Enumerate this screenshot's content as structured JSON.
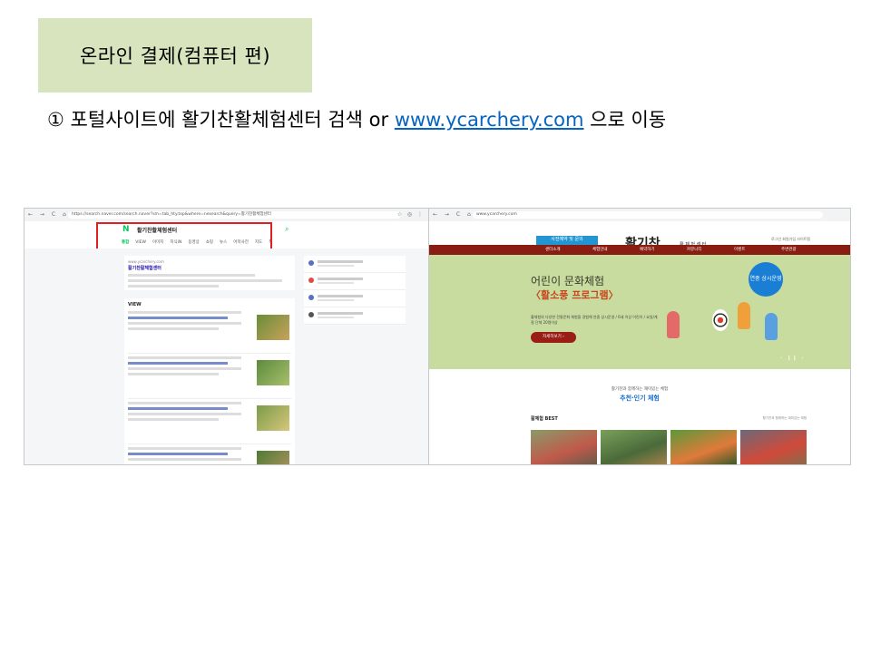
{
  "slide": {
    "title": "온라인 결제(컴퓨터 편)",
    "step_prefix": "① 포털사이트에 활기찬활체험센터 검색 or ",
    "step_link": "www.ycarchery.com",
    "step_suffix": " 으로 이동"
  },
  "left_screenshot": {
    "nav_buttons": "← → C ⌂",
    "url": "https://search.naver.com/search.naver?sm=tab_hty.top&where=nexearch&query=활기찬활체험센터",
    "right_icons": "☆ ◎ ⋮",
    "logo": "N",
    "query": "활기찬활체험센터",
    "search_icon": "search-icon",
    "tabs": [
      "통합",
      "VIEW",
      "이미지",
      "지식iN",
      "동영상",
      "쇼핑",
      "뉴스",
      "어학사전",
      "지도",
      "책"
    ],
    "active_tab": "통합",
    "result_url": "www.ycarchery.com",
    "result_title": "활기찬활체험센터",
    "view_label": "VIEW"
  },
  "right_screenshot": {
    "nav_buttons": "← → C ⌂",
    "url": "www.ycarchery.com",
    "reserve_line1": "사전예약 및 문의",
    "reserve_line2": "054-653-2434",
    "logo": "활기찬",
    "logo_sub": "활 체 험 센 터",
    "top_links": "로그인   회원가입   사이트맵",
    "nav_items": [
      "센터소개",
      "체험안내",
      "예약하기",
      "커뮤니티",
      "이벤트",
      "주변관광"
    ],
    "hero_title": "어린이 문화체험",
    "hero_subtitle": "〈활소풍 프로그램〉",
    "hero_desc": "활체험의 다양한 전통문화 체험을 경험해 연중 상시운영 / 6세 이상 어린이 / 요일/계절 단체 20명이상",
    "hero_button": "자세히보기  ›",
    "badge": "연중 상시운영",
    "arrows": "‹ ❙❙ ›",
    "mid_sub": "활기찬과 함께하는 재미있는 체험",
    "mid_title_a": "추천·",
    "mid_title_b": "인기 체험",
    "best_label": "활체험 BEST",
    "best_right": "활기찬과 함께하는 재미있는 체험"
  }
}
